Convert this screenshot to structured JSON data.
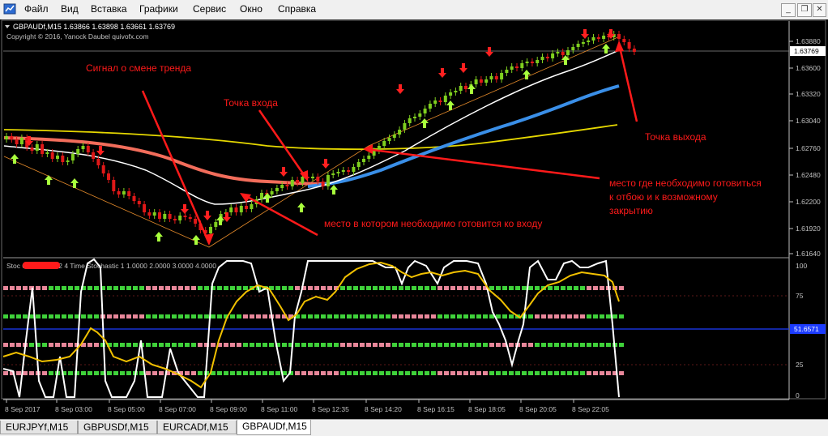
{
  "menu": {
    "items": [
      "Файл",
      "Вид",
      "Вставка",
      "Графики",
      "Сервис",
      "Окно",
      "Справка"
    ]
  },
  "chart": {
    "header": "GBPAUDf,M15  1.63866 1.63898 1.63661 1.63769",
    "copyright": "Copyright © 2016, Yanock Daubel  quivofx.com",
    "current_price": "1.63769",
    "price_ticks": [
      "1.63880",
      "1.63600",
      "1.63320",
      "1.63040",
      "1.62760",
      "1.62480",
      "1.62200",
      "1.61920",
      "1.61640"
    ],
    "indicator_label": "Stoc 0000 70.7 02  4 Time Stochastic 1 1.0000 2.0000 3.0000 4.0000",
    "indicator_ticks": [
      "100",
      "75",
      "50",
      "25",
      "0"
    ],
    "indicator_level_value": "51.6571",
    "time_labels": [
      "8 Sep 2017",
      "8 Sep 03:00",
      "8 Sep 05:00",
      "8 Sep 07:00",
      "8 Sep 09:00",
      "8 Sep 11:00",
      "8 Sep 12:35",
      "8 Sep 14:20",
      "8 Sep 16:15",
      "8 Sep 18:05",
      "8 Sep 20:05",
      "8 Sep 22:05"
    ]
  },
  "annotations": {
    "signal": "Сигнал о смене тренда",
    "entry": "Точка входа",
    "exit": "Точка выхода",
    "prepare_exit": "место где необходимо готовиться к отбою и к возможному закрытию",
    "prepare_entry": "место в котором необходимо готовится ко входу"
  },
  "tabs": [
    "EURJPYf,M15",
    "GBPUSDf,M15",
    "EURCADf,M15",
    "GBPAUDf,M15"
  ],
  "active_tab": "GBPAUDf,M15",
  "colors": {
    "bull": "#7fcf1f",
    "bear": "#e01818",
    "ma_white": "#ffffff",
    "ma_salmon": "#f26d5b",
    "ma_blue": "#3a8fe8",
    "ma_yellow": "#e6d800",
    "annotation": "#ff1a1a"
  },
  "icons": [
    "app-icon",
    "minimize-icon",
    "restore-icon",
    "close-icon",
    "up-arrow-icon",
    "down-arrow-icon"
  ]
}
